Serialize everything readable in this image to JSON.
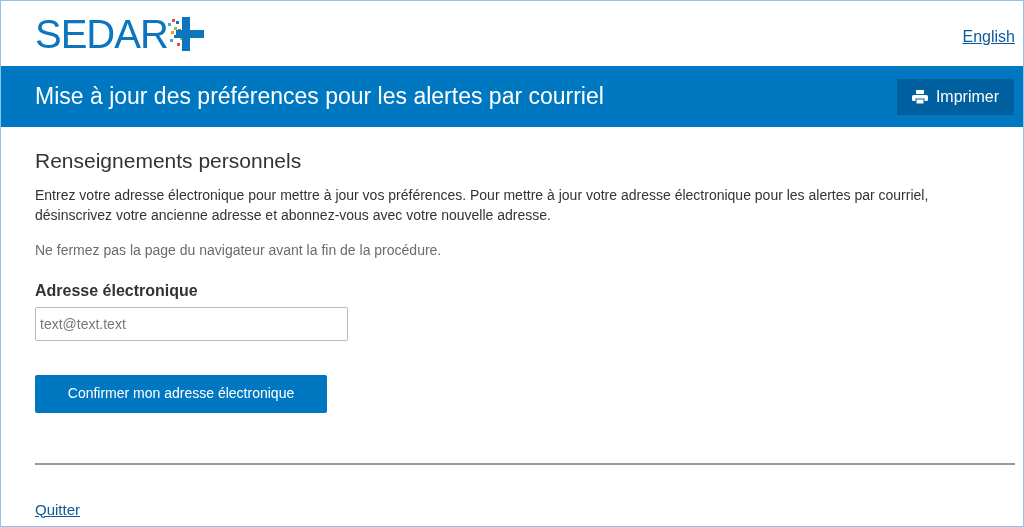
{
  "header": {
    "logo": "SEDAR",
    "language_link": "English"
  },
  "banner": {
    "title": "Mise à jour des préférences pour les alertes par courriel",
    "print_button": "Imprimer"
  },
  "section": {
    "heading": "Renseignements personnels",
    "intro": "Entrez votre adresse électronique pour mettre à jour vos préférences. Pour mettre à jour votre adresse électronique pour les alertes par courriel, désinscrivez votre ancienne adresse et abonnez-vous avec votre nouvelle adresse.",
    "note": "Ne fermez pas la page du navigateur avant la fin de la procédure.",
    "email_field": {
      "label": "Adresse électronique",
      "placeholder": "text@text.text"
    },
    "confirm_button": "Confirmer mon adresse électronique"
  },
  "footer": {
    "quit_link": "Quitter"
  }
}
